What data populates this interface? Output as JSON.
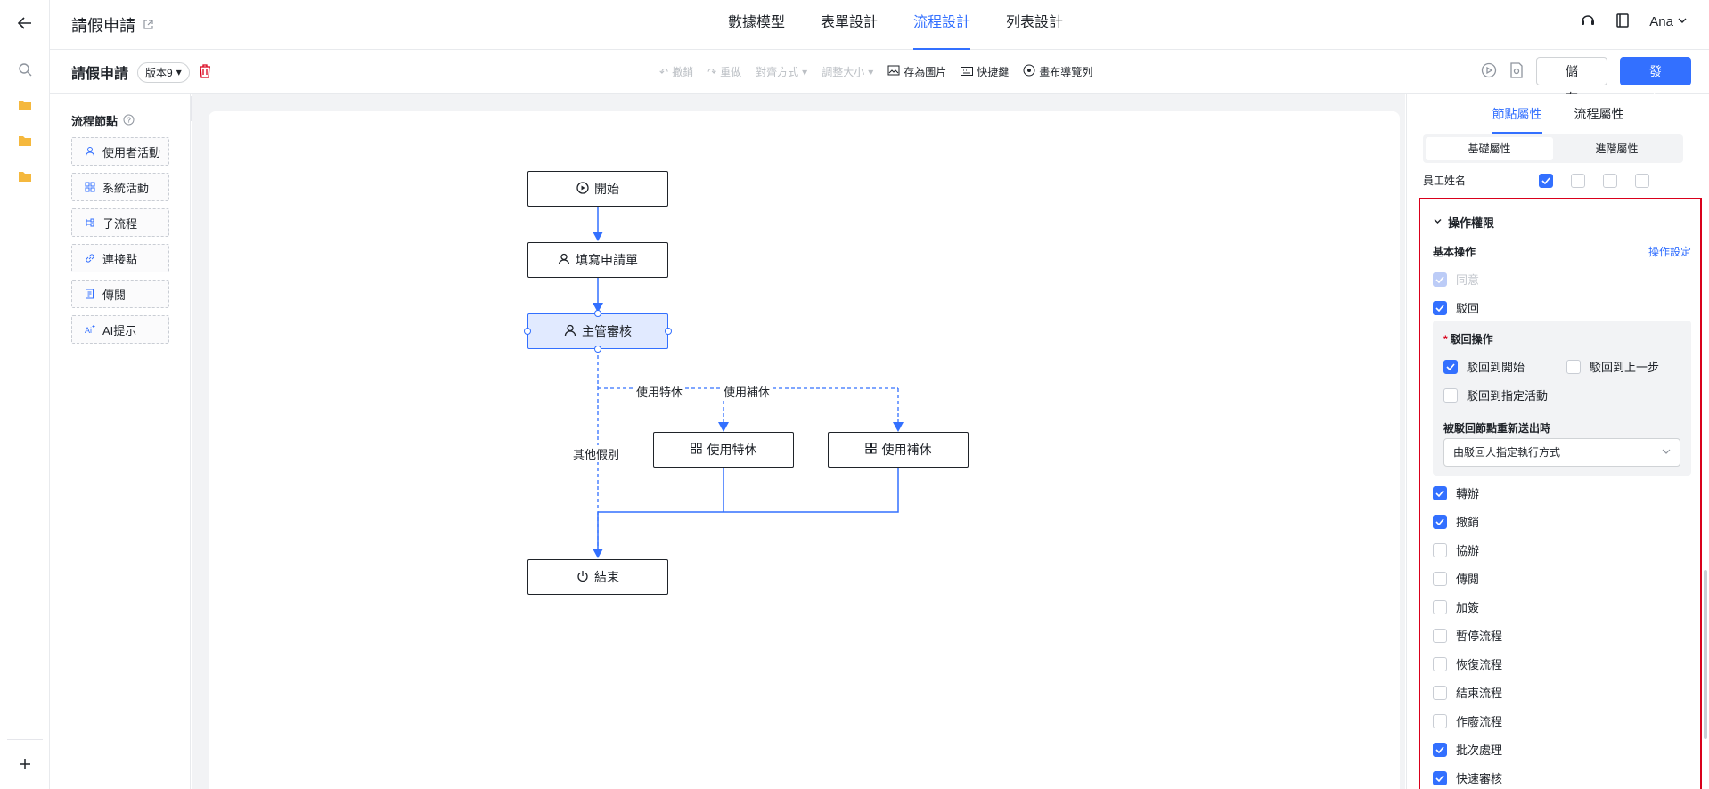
{
  "header": {
    "title": "請假申請",
    "tabs": [
      {
        "label": "數據模型"
      },
      {
        "label": "表單設計"
      },
      {
        "label": "流程設計"
      },
      {
        "label": "列表設計"
      }
    ],
    "active_tab": "流程設計",
    "user": "Ana"
  },
  "toolbar": {
    "form_name": "請假申請",
    "version": "版本9",
    "undo": "撤銷",
    "redo": "重做",
    "align": "對齊方式",
    "resize": "調整大小",
    "save_image": "存為圖片",
    "shortcuts": "快捷鍵",
    "nav_list": "畫布導覽列",
    "save": "儲 存",
    "publish": "發 布"
  },
  "palette": {
    "title": "流程節點",
    "items": [
      {
        "label": "使用者活動",
        "icon": "user-icon"
      },
      {
        "label": "系統活動",
        "icon": "grid-icon"
      },
      {
        "label": "子流程",
        "icon": "subflow-icon"
      },
      {
        "label": "連接點",
        "icon": "link-icon"
      },
      {
        "label": "傳閱",
        "icon": "document-icon"
      },
      {
        "label": "AI提示",
        "icon": "ai-icon"
      }
    ]
  },
  "flow": {
    "nodes": {
      "start": "開始",
      "fill": "填寫申請單",
      "review": "主管審核",
      "special": "使用特休",
      "comp": "使用補休",
      "end": "結束"
    },
    "edges": {
      "special": "使用特休",
      "comp": "使用補休",
      "other": "其他假別"
    }
  },
  "panel": {
    "tabs": [
      "節點屬性",
      "流程屬性"
    ],
    "seg": [
      "基礎屬性",
      "進階屬性"
    ],
    "employee_name": "員工姓名",
    "section_title": "操作權限",
    "basic_ops": "基本操作",
    "op_settings": "操作設定",
    "agree": "同意",
    "reject": "駁回",
    "reject_ops_label": "駁回操作",
    "reject_to_start": "駁回到開始",
    "reject_to_prev": "駁回到上一步",
    "reject_to_activity": "駁回到指定活動",
    "resubmit_label": "被駁回節點重新送出時",
    "resubmit_value": "由駁回人指定執行方式",
    "ops": [
      {
        "label": "轉辦",
        "checked": true
      },
      {
        "label": "撤銷",
        "checked": true
      },
      {
        "label": "協辦",
        "checked": false
      },
      {
        "label": "傳閱",
        "checked": false
      },
      {
        "label": "加簽",
        "checked": false
      },
      {
        "label": "暫停流程",
        "checked": false
      },
      {
        "label": "恢復流程",
        "checked": false
      },
      {
        "label": "結束流程",
        "checked": false
      },
      {
        "label": "作廢流程",
        "checked": false
      },
      {
        "label": "批次處理",
        "checked": true
      },
      {
        "label": "快速審核",
        "checked": true
      }
    ]
  }
}
